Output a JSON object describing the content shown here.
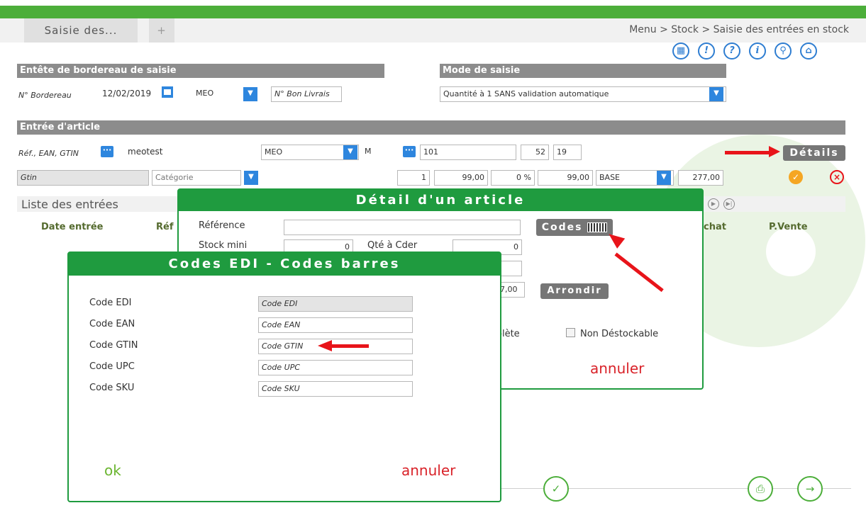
{
  "header": {
    "tab_label": "Saisie des...",
    "new_tab_label": "+",
    "breadcrumb": "Menu > Stock > Saisie des entrées en stock"
  },
  "toolbar_icons": [
    "calendar-icon",
    "alert-icon",
    "help-icon",
    "info-icon",
    "search-icon",
    "home-icon"
  ],
  "entete": {
    "title": "Entête de bordereau de saisie",
    "bordereau_label": "N° Bordereau",
    "date_value": "12/02/2019",
    "meo_value": "MEO",
    "bon_livraison_placeholder": "N° Bon Livrais"
  },
  "mode_saisie": {
    "title": "Mode de saisie",
    "value": "Quantité à 1 SANS validation automatique"
  },
  "entree_article": {
    "title": "Entrée d'article",
    "ref_label": "Réf., EAN, GTIN",
    "ref_value": "meotest",
    "supplier_value": "MEO",
    "unit_value": "M",
    "code_value": "101",
    "num1": "52",
    "num2": "19",
    "details_label": "Détails",
    "gtin_label": "Gtin",
    "categorie_placeholder": "Catégorie",
    "qty": "1",
    "price": "99,00",
    "discount": "0 %",
    "net": "99,00",
    "base_value": "BASE",
    "total": "277,00"
  },
  "liste": {
    "title": "Liste des entrées",
    "col_date": "Date entrée",
    "col_ref": "Réf",
    "col_achat": "chat",
    "col_vente": "P.Vente"
  },
  "detail_dialog": {
    "title": "Détail d'un article",
    "reference_label": "Référence",
    "stock_mini_label": "Stock mini",
    "stock_mini_value": "0",
    "qte_cder_label": "Qté à Cder",
    "qte_cder_value": "0",
    "partial_value": "7,00",
    "codes_label": "Codes",
    "arrondir_label": "Arrondir",
    "obsolete_label": "olète",
    "non_destockable_label": "Non Déstockable",
    "cancel_label": "annuler"
  },
  "codes_dialog": {
    "title": "Codes EDI - Codes barres",
    "rows": [
      {
        "label": "Code EDI",
        "placeholder": "Code EDI"
      },
      {
        "label": "Code EAN",
        "placeholder": "Code EAN"
      },
      {
        "label": "Code GTIN",
        "placeholder": "Code GTIN"
      },
      {
        "label": "Code UPC",
        "placeholder": "Code UPC"
      },
      {
        "label": "Code SKU",
        "placeholder": "Code SKU"
      }
    ],
    "ok_label": "ok",
    "cancel_label": "annuler"
  },
  "colors": {
    "brand_green": "#4cae3a",
    "dialog_green": "#1f9b3f",
    "accent_blue": "#2e86de",
    "arrow_red": "#e8141a",
    "cancel_red": "#d9232a",
    "ok_green": "#6ab52f"
  }
}
